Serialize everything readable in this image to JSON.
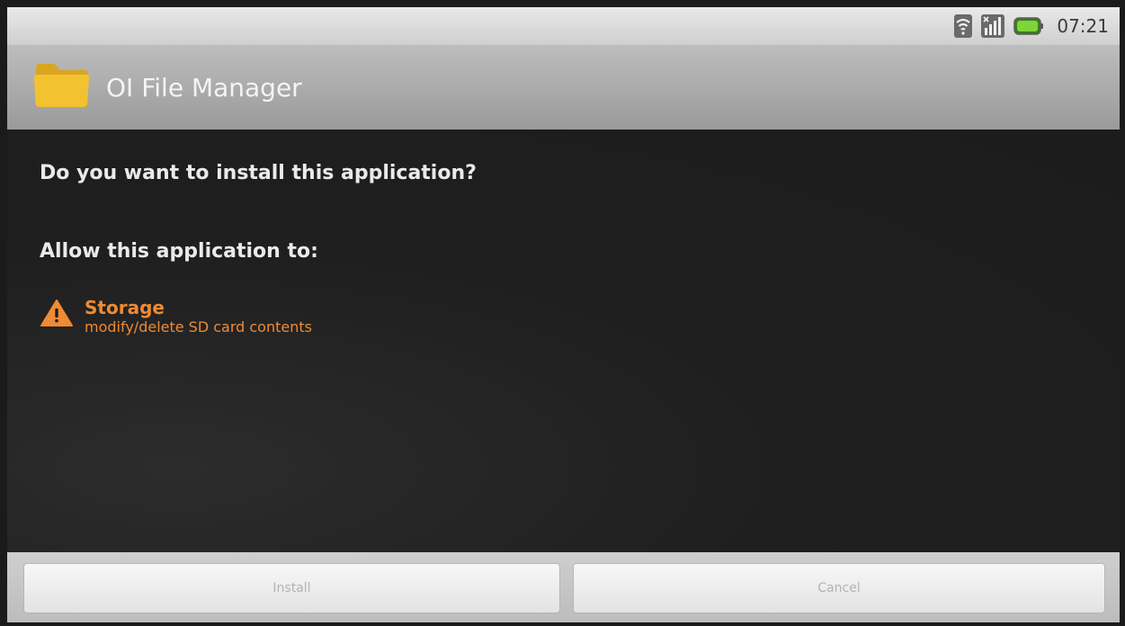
{
  "status_bar": {
    "time": "07:21",
    "icons": [
      "wifi-icon",
      "signal-icon",
      "battery-icon"
    ]
  },
  "title_bar": {
    "app_name": "OI File Manager",
    "icon": "folder-icon"
  },
  "content": {
    "question": "Do you want to install this application?",
    "allow_heading": "Allow this application to:",
    "permissions": [
      {
        "icon": "warning-icon",
        "title": "Storage",
        "description": "modify/delete SD card contents"
      }
    ]
  },
  "buttons": {
    "install_label": "Install",
    "cancel_label": "Cancel"
  },
  "colors": {
    "permission_orange": "#ef8a35",
    "background": "#1e1e1e"
  }
}
